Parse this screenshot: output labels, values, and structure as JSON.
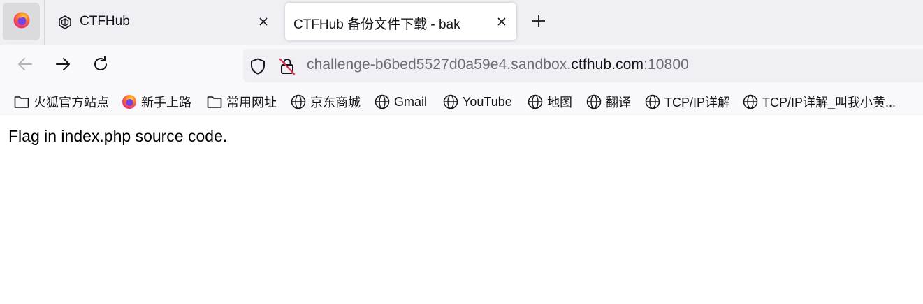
{
  "colors": {
    "tabstrip_bg": "#f0f0f4",
    "toolbar_bg": "#f9f9fb",
    "active_tab_bg": "#ffffff",
    "text": "#15141a",
    "url_dim": "#6c6c75",
    "firefox_orange": "#ff7139",
    "firefox_purple": "#7542e5"
  },
  "tabs": [
    {
      "title": "CTFHub",
      "icon": "ctfhub-icon",
      "active": false
    },
    {
      "title": "CTFHub 备份文件下载 - bak",
      "active": true
    }
  ],
  "nav": {
    "back_icon": "arrow-left-icon",
    "forward_icon": "arrow-right-icon",
    "reload_icon": "reload-icon"
  },
  "url": {
    "prefix": "challenge-b6bed5527d0a59e4.sandbox.",
    "domain": "ctfhub.com",
    "port": ":10800"
  },
  "bookmarks": [
    {
      "label": "火狐官方站点",
      "icon": "folder-icon"
    },
    {
      "label": "新手上路",
      "icon": "firefox-icon"
    },
    {
      "label": "常用网址",
      "icon": "folder-icon"
    },
    {
      "label": "京东商城",
      "icon": "globe-icon"
    },
    {
      "label": "Gmail",
      "icon": "globe-icon"
    },
    {
      "label": "YouTube",
      "icon": "globe-icon"
    },
    {
      "label": "地图",
      "icon": "globe-icon"
    },
    {
      "label": "翻译",
      "icon": "globe-icon"
    },
    {
      "label": "TCP/IP详解",
      "icon": "globe-icon"
    },
    {
      "label": "TCP/IP详解_叫我小黄...",
      "icon": "globe-icon"
    }
  ],
  "page": {
    "text": "Flag in index.php source code."
  }
}
